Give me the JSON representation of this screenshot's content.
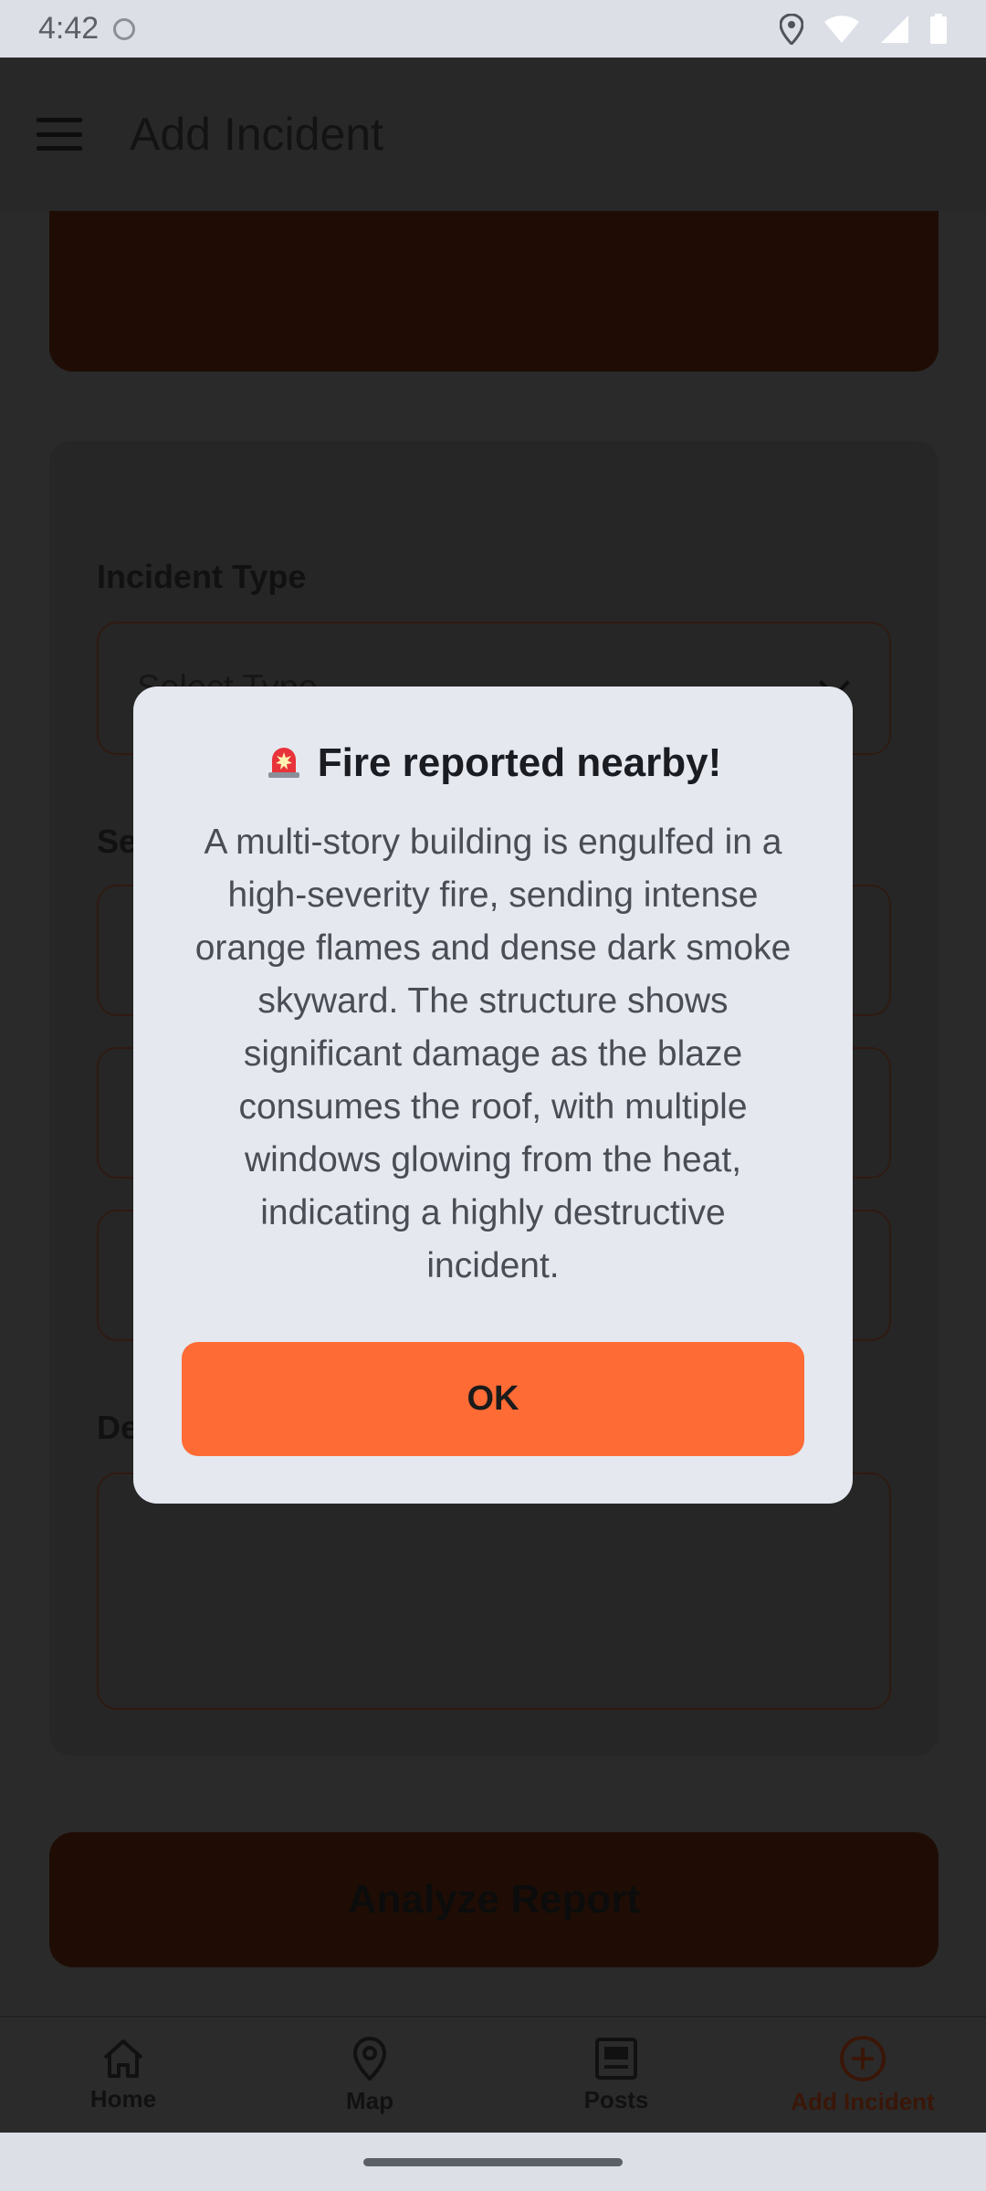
{
  "status_bar": {
    "time": "4:42"
  },
  "app": {
    "title": "Add Incident",
    "form": {
      "incident_type_label": "Incident Type",
      "select_placeholder": "Select Type"
    },
    "analyze_button": "Analyze Report",
    "nav": [
      {
        "label": "Home",
        "icon": "home-icon"
      },
      {
        "label": "Map",
        "icon": "map-pin-icon"
      },
      {
        "label": "Posts",
        "icon": "posts-icon"
      },
      {
        "label": "Add Incident",
        "icon": "add-circle-icon"
      }
    ]
  },
  "dialog": {
    "title": "Fire reported nearby!",
    "body": "A multi-story building is engulfed in a high-severity fire, sending intense orange flames and dense dark smoke skyward. The structure shows significant damage as the blaze consumes the roof, with multiple windows glowing from the heat, indicating a highly destructive incident.",
    "ok_label": "OK",
    "accent_color": "#ff6b35"
  }
}
